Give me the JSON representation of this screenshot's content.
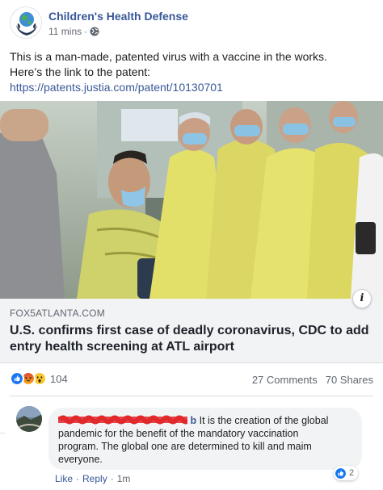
{
  "post": {
    "page_name": "Children's Health Defense",
    "time": "11 mins",
    "separator": "·",
    "privacy_icon": "globe-icon",
    "text_line1": "This is a man-made, patented virus with a vaccine in the works.",
    "text_line2": "Here’s the link to the patent:",
    "link": "https://patents.justia.com/patent/10130701"
  },
  "link_preview": {
    "domain": "FOX5ATLANTA.COM",
    "headline_line1": "U.S. confirms first case of deadly coronavirus, CDC to add",
    "headline_line2": "entry health screening at ATL airport",
    "info_label": "i"
  },
  "stats": {
    "reaction_icons": [
      "like-icon",
      "angry-icon",
      "wow-icon"
    ],
    "reaction_count": "104",
    "comments": "27 Comments",
    "shares": "70 Shares"
  },
  "comment": {
    "name_tail": "b",
    "line1": "It is the creation of the global",
    "line2": "pandemic for the benefit of the mandatory vaccination",
    "line3": "program. The global one are determined to kill and maim",
    "line4": "everyone.",
    "like_count": "2",
    "action_like": "Like",
    "action_reply": "Reply",
    "dot": "·",
    "time": "1m"
  },
  "colors": {
    "link_blue": "#385898",
    "like_blue": "#1877f2",
    "redaction_red": "#e0282c",
    "preview_bg": "#f2f3f5"
  }
}
